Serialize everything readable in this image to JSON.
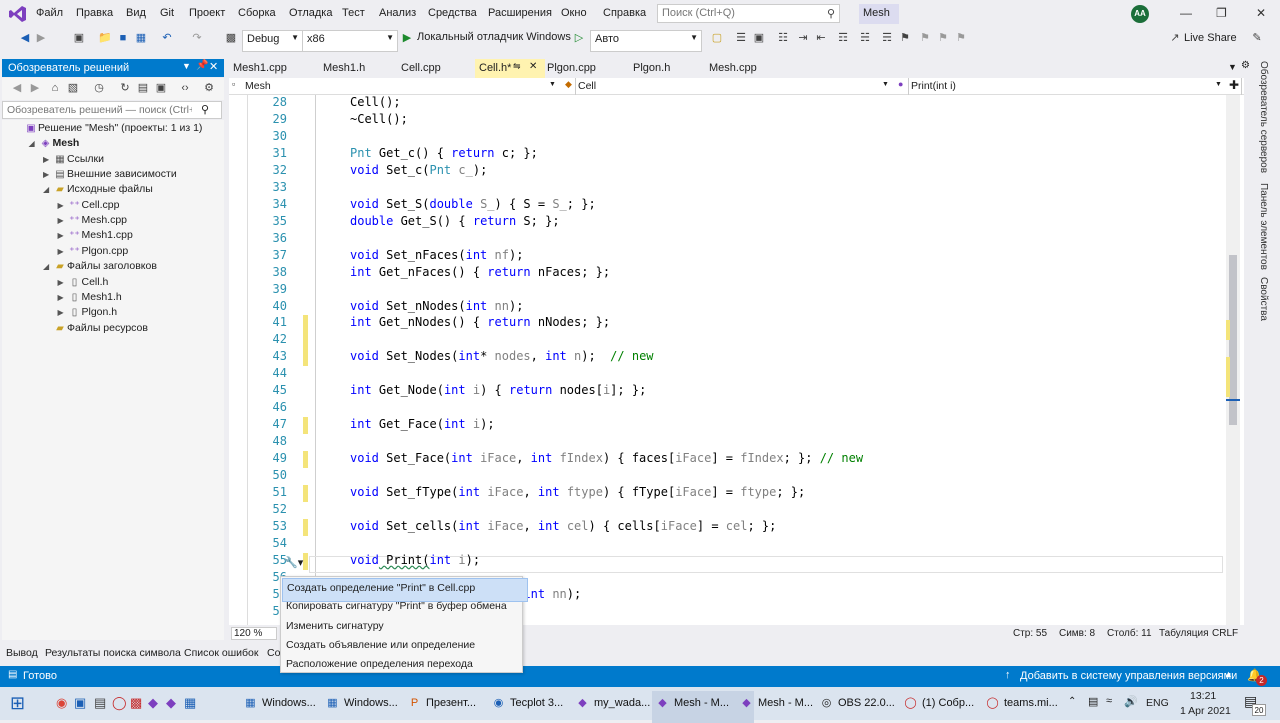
{
  "menu": {
    "items": [
      "Файл",
      "Правка",
      "Вид",
      "Git",
      "Проект",
      "Сборка",
      "Отладка",
      "Тест",
      "Анализ",
      "Средства",
      "Расширения",
      "Окно",
      "Справка"
    ],
    "search_placeholder": "Поиск (Ctrl+Q)",
    "solution_badge": "Mesh",
    "avatar_initials": "AA"
  },
  "toolbar": {
    "config": "Debug",
    "platform": "x86",
    "debugger": "Локальный отладчик Windows",
    "auto": "Авто",
    "live_share": "Live Share"
  },
  "solution_explorer": {
    "title": "Обозреватель решений",
    "search_placeholder": "Обозреватель решений — поиск (Ctrl+;)",
    "tree": [
      {
        "label": "Решение \"Mesh\" (проекты: 1 из 1)",
        "indent": 0,
        "expander": "",
        "icon": "solution-icon",
        "bold": false
      },
      {
        "label": "Mesh",
        "indent": 1,
        "expander": "◢",
        "icon": "project-icon",
        "bold": true
      },
      {
        "label": "Ссылки",
        "indent": 2,
        "expander": "▶",
        "icon": "references-icon",
        "bold": false
      },
      {
        "label": "Внешние зависимости",
        "indent": 2,
        "expander": "▶",
        "icon": "external-deps-icon",
        "bold": false
      },
      {
        "label": "Исходные файлы",
        "indent": 2,
        "expander": "◢",
        "icon": "folder-icon",
        "bold": false
      },
      {
        "label": "Cell.cpp",
        "indent": 3,
        "expander": "▶",
        "icon": "cpp-file-icon",
        "bold": false
      },
      {
        "label": "Mesh.cpp",
        "indent": 3,
        "expander": "▶",
        "icon": "cpp-file-icon",
        "bold": false
      },
      {
        "label": "Mesh1.cpp",
        "indent": 3,
        "expander": "▶",
        "icon": "cpp-file-icon",
        "bold": false
      },
      {
        "label": "Plgon.cpp",
        "indent": 3,
        "expander": "▶",
        "icon": "cpp-file-icon",
        "bold": false
      },
      {
        "label": "Файлы заголовков",
        "indent": 2,
        "expander": "◢",
        "icon": "folder-icon",
        "bold": false
      },
      {
        "label": "Cell.h",
        "indent": 3,
        "expander": "▶",
        "icon": "h-file-icon",
        "bold": false
      },
      {
        "label": "Mesh1.h",
        "indent": 3,
        "expander": "▶",
        "icon": "h-file-icon",
        "bold": false
      },
      {
        "label": "Plgon.h",
        "indent": 3,
        "expander": "▶",
        "icon": "h-file-icon",
        "bold": false
      },
      {
        "label": "Файлы ресурсов",
        "indent": 2,
        "expander": "",
        "icon": "folder-icon",
        "bold": false
      }
    ]
  },
  "tabs": [
    {
      "label": "Mesh1.cpp",
      "active": false
    },
    {
      "label": "Mesh1.h",
      "active": false
    },
    {
      "label": "Cell.cpp",
      "active": false
    },
    {
      "label": "Cell.h*",
      "active": true
    },
    {
      "label": "Plgon.cpp",
      "active": false
    },
    {
      "label": "Plgon.h",
      "active": false
    },
    {
      "label": "Mesh.cpp",
      "active": false
    }
  ],
  "navbar": {
    "project": "Mesh",
    "class": "Cell",
    "member": "Print(int i)"
  },
  "code_lines": [
    {
      "n": "28",
      "tokens": [
        [
          "t",
          "Cell();"
        ]
      ]
    },
    {
      "n": "29",
      "tokens": [
        [
          "t",
          "~Cell();"
        ]
      ]
    },
    {
      "n": "30",
      "tokens": []
    },
    {
      "n": "31",
      "tokens": [
        [
          "ty",
          "Pnt"
        ],
        [
          "t",
          " Get_c() { "
        ],
        [
          "kw",
          "return"
        ],
        [
          "t",
          " c; };"
        ]
      ]
    },
    {
      "n": "32",
      "tokens": [
        [
          "kw",
          "void"
        ],
        [
          "t",
          " Set_c("
        ],
        [
          "ty",
          "Pnt"
        ],
        [
          "t",
          " "
        ],
        [
          "pm",
          "c_"
        ],
        [
          "t",
          ");"
        ]
      ]
    },
    {
      "n": "33",
      "tokens": []
    },
    {
      "n": "34",
      "tokens": [
        [
          "kw",
          "void"
        ],
        [
          "t",
          " Set_S("
        ],
        [
          "kw",
          "double"
        ],
        [
          "t",
          " "
        ],
        [
          "pm",
          "S_"
        ],
        [
          "t",
          ") { S = "
        ],
        [
          "pm",
          "S_"
        ],
        [
          "t",
          "; };"
        ]
      ]
    },
    {
      "n": "35",
      "tokens": [
        [
          "kw",
          "double"
        ],
        [
          "t",
          " Get_S() { "
        ],
        [
          "kw",
          "return"
        ],
        [
          "t",
          " S; };"
        ]
      ]
    },
    {
      "n": "36",
      "tokens": []
    },
    {
      "n": "37",
      "tokens": [
        [
          "kw",
          "void"
        ],
        [
          "t",
          " Set_nFaces("
        ],
        [
          "kw",
          "int"
        ],
        [
          "t",
          " "
        ],
        [
          "pm",
          "nf"
        ],
        [
          "t",
          ");"
        ]
      ]
    },
    {
      "n": "38",
      "tokens": [
        [
          "kw",
          "int"
        ],
        [
          "t",
          " Get_nFaces() { "
        ],
        [
          "kw",
          "return"
        ],
        [
          "t",
          " nFaces; };"
        ]
      ]
    },
    {
      "n": "39",
      "tokens": []
    },
    {
      "n": "40",
      "tokens": [
        [
          "kw",
          "void"
        ],
        [
          "t",
          " Set_nNodes("
        ],
        [
          "kw",
          "int"
        ],
        [
          "t",
          " "
        ],
        [
          "pm",
          "nn"
        ],
        [
          "t",
          ");"
        ]
      ]
    },
    {
      "n": "41",
      "tokens": [
        [
          "kw",
          "int"
        ],
        [
          "t",
          " Get_nNodes() { "
        ],
        [
          "kw",
          "return"
        ],
        [
          "t",
          " nNodes; };"
        ]
      ]
    },
    {
      "n": "42",
      "tokens": []
    },
    {
      "n": "43",
      "tokens": [
        [
          "kw",
          "void"
        ],
        [
          "t",
          " Set_Nodes("
        ],
        [
          "kw",
          "int"
        ],
        [
          "t",
          "* "
        ],
        [
          "pm",
          "nodes"
        ],
        [
          "t",
          ", "
        ],
        [
          "kw",
          "int"
        ],
        [
          "t",
          " "
        ],
        [
          "pm",
          "n"
        ],
        [
          "t",
          ");  "
        ],
        [
          "cm",
          "// new"
        ]
      ]
    },
    {
      "n": "44",
      "tokens": []
    },
    {
      "n": "45",
      "tokens": [
        [
          "kw",
          "int"
        ],
        [
          "t",
          " Get_Node("
        ],
        [
          "kw",
          "int"
        ],
        [
          "t",
          " "
        ],
        [
          "pm",
          "i"
        ],
        [
          "t",
          ") { "
        ],
        [
          "kw",
          "return"
        ],
        [
          "t",
          " nodes["
        ],
        [
          "pm",
          "i"
        ],
        [
          "t",
          "]; };"
        ]
      ]
    },
    {
      "n": "46",
      "tokens": []
    },
    {
      "n": "47",
      "tokens": [
        [
          "kw",
          "int"
        ],
        [
          "t",
          " Get_Face("
        ],
        [
          "kw",
          "int"
        ],
        [
          "t",
          " "
        ],
        [
          "pm",
          "i"
        ],
        [
          "t",
          ");"
        ]
      ]
    },
    {
      "n": "48",
      "tokens": []
    },
    {
      "n": "49",
      "tokens": [
        [
          "kw",
          "void"
        ],
        [
          "t",
          " Set_Face("
        ],
        [
          "kw",
          "int"
        ],
        [
          "t",
          " "
        ],
        [
          "pm",
          "iFace"
        ],
        [
          "t",
          ", "
        ],
        [
          "kw",
          "int"
        ],
        [
          "t",
          " "
        ],
        [
          "pm",
          "fIndex"
        ],
        [
          "t",
          ") { faces["
        ],
        [
          "pm",
          "iFace"
        ],
        [
          "t",
          "] = "
        ],
        [
          "pm",
          "fIndex"
        ],
        [
          "t",
          "; }; "
        ],
        [
          "cm",
          "// new"
        ]
      ]
    },
    {
      "n": "50",
      "tokens": []
    },
    {
      "n": "51",
      "tokens": [
        [
          "kw",
          "void"
        ],
        [
          "t",
          " Set_fType("
        ],
        [
          "kw",
          "int"
        ],
        [
          "t",
          " "
        ],
        [
          "pm",
          "iFace"
        ],
        [
          "t",
          ", "
        ],
        [
          "kw",
          "int"
        ],
        [
          "t",
          " "
        ],
        [
          "pm",
          "ftype"
        ],
        [
          "t",
          ") { fType["
        ],
        [
          "pm",
          "iFace"
        ],
        [
          "t",
          "] = "
        ],
        [
          "pm",
          "ftype"
        ],
        [
          "t",
          "; };"
        ]
      ]
    },
    {
      "n": "52",
      "tokens": []
    },
    {
      "n": "53",
      "tokens": [
        [
          "kw",
          "void"
        ],
        [
          "t",
          " Set_cells("
        ],
        [
          "kw",
          "int"
        ],
        [
          "t",
          " "
        ],
        [
          "pm",
          "iFace"
        ],
        [
          "t",
          ", "
        ],
        [
          "kw",
          "int"
        ],
        [
          "t",
          " "
        ],
        [
          "pm",
          "cel"
        ],
        [
          "t",
          ") { cells["
        ],
        [
          "pm",
          "iFace"
        ],
        [
          "t",
          "] = "
        ],
        [
          "pm",
          "cel"
        ],
        [
          "t",
          "; };"
        ]
      ]
    },
    {
      "n": "54",
      "tokens": []
    },
    {
      "n": "55",
      "tokens": [
        [
          "kw",
          "void"
        ],
        [
          "t",
          " Print("
        ],
        [
          "kw",
          "int"
        ],
        [
          "t",
          " "
        ],
        [
          "pm",
          "i"
        ],
        [
          "t",
          ");"
        ]
      ]
    },
    {
      "n": "56",
      "tokens": []
    },
    {
      "n": "57",
      "tokens": [
        [
          "t",
          "                    "
        ],
        [
          "pm",
          "s_"
        ],
        [
          "t",
          ", "
        ],
        [
          "kw",
          "int"
        ],
        [
          "t",
          " "
        ],
        [
          "pm",
          "nn"
        ],
        [
          "t",
          ");"
        ]
      ]
    },
    {
      "n": "58",
      "tokens": []
    }
  ],
  "quick_actions": [
    "Создать определение \"Print\" в Cell.cpp",
    "Копировать сигнатуру \"Print\" в буфер обмена",
    "Изменить сигнатуру",
    "Создать объявление или определение",
    "Расположение определения перехода"
  ],
  "editor_status": {
    "zoom": "120 %",
    "line": "Стр: 55",
    "char": "Симв: 8",
    "col": "Столб: 11",
    "tabs": "Табуляция",
    "eol": "CRLF"
  },
  "bottom_tabs": [
    "Вывод",
    "Результаты поиска символа",
    "Список ошибок",
    "Со"
  ],
  "status_bar": {
    "ready": "Готово",
    "vcs": "Добавить в систему управления версиями",
    "notifications": "2"
  },
  "right_rail": [
    "Обозреватель серверов",
    "Панель элементов",
    "Свойства"
  ],
  "taskbar": {
    "items": [
      "Windows...",
      "Windows...",
      "Презент...",
      "Tecplot 3...",
      "my_wada...",
      "Mesh - M...",
      "Mesh - M...",
      "OBS 22.0...",
      "(1) Собр...",
      "teams.mi..."
    ],
    "lang": "ENG",
    "time": "13:21",
    "date": "1 Apr 2021",
    "badge": "20"
  },
  "colors": {
    "accent": "#007acc",
    "taskbar": "#dbe4ef",
    "active_tab": "#fff3b0"
  }
}
